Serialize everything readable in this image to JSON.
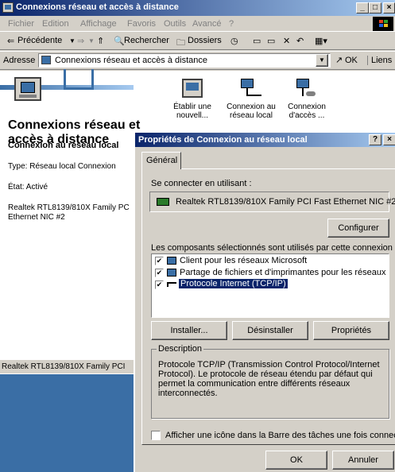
{
  "window": {
    "title": "Connexions réseau et accès à distance"
  },
  "menu": [
    "Fichier",
    "Edition",
    "Affichage",
    "Favoris",
    "Outils",
    "Avancé",
    "?"
  ],
  "toolbar": {
    "back": "Précédente",
    "search": "Rechercher",
    "folders": "Dossiers"
  },
  "address": {
    "label": "Adresse",
    "value": "Connexions réseau et accès à distance",
    "go": "OK",
    "links": "Liens"
  },
  "folder": {
    "heading_line1": "Connexions réseau et",
    "heading_line2": "accès à distance",
    "icons": [
      {
        "label1": "Établir une",
        "label2": "nouvell..."
      },
      {
        "label1": "Connexion au",
        "label2": "réseau local"
      },
      {
        "label1": "Connexion",
        "label2": "d'accès ..."
      }
    ]
  },
  "left_pane": {
    "title": "Connexion au réseau local",
    "type": "Type: Réseau local Connexion",
    "state": "État: Activé",
    "device_line1": "Realtek RTL8139/810X Family PC",
    "device_line2": "Ethernet NIC #2",
    "status": "Realtek RTL8139/810X Family PCI"
  },
  "dialog": {
    "title": "Propriétés de Connexion au réseau local",
    "help": "?",
    "tab": "Général",
    "connect_using_label": "Se connecter en utilisant :",
    "adapter": "Realtek RTL8139/810X Family PCI Fast Ethernet NIC #2",
    "configure": "Configurer",
    "components_label": "Les composants sélectionnés sont utilisés par cette connexion :",
    "components": [
      {
        "label": "Client pour les réseaux Microsoft",
        "checked": true
      },
      {
        "label": "Partage de fichiers et d'imprimantes pour les réseaux Micr...",
        "checked": true
      },
      {
        "label": "Protocole Internet (TCP/IP)",
        "checked": true
      }
    ],
    "install": "Installer...",
    "uninstall": "Désinstaller",
    "properties": "Propriétés",
    "description_label": "Description",
    "description_line1": "Protocole TCP/IP (Transmission Control Protocol/Internet",
    "description_line2": "Protocol). Le protocole de réseau étendu par défaut qui",
    "description_line3": "permet la communication entre différents réseaux",
    "description_line4": "interconnectés.",
    "show_icon": "Afficher une icône dans la Barre des tâches une fois connecté",
    "ok": "OK",
    "cancel": "Annuler"
  }
}
